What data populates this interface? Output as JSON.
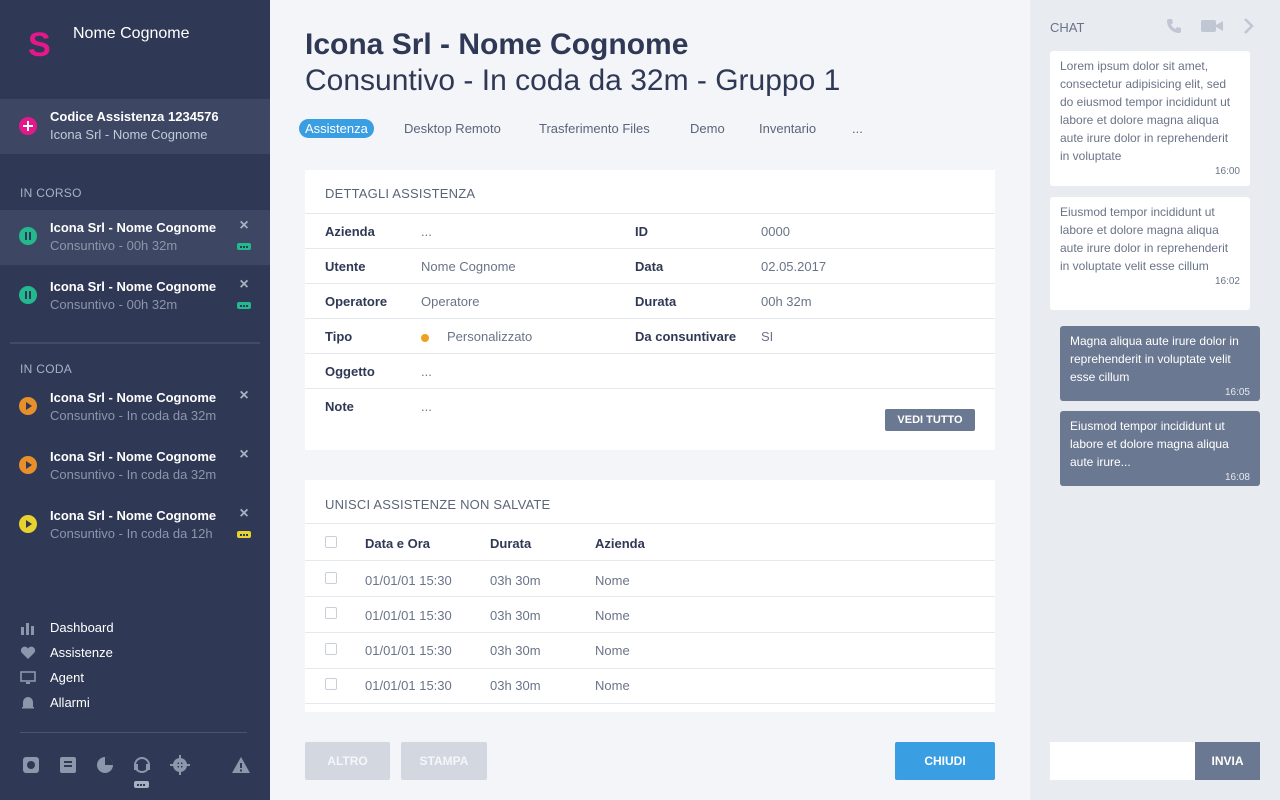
{
  "user": {
    "logo": "S",
    "name": "Nome Cognome"
  },
  "code_box": {
    "title": "Codice Assistenza 1234576",
    "subtitle": "Icona Srl - Nome Cognome"
  },
  "in_corso": {
    "title": "IN CORSO",
    "items": [
      {
        "title": "Icona Srl - Nome Cognome",
        "subtitle": "Consuntivo - 00h 32m",
        "status": "pause",
        "badge": "green"
      },
      {
        "title": "Icona Srl - Nome Cognome",
        "subtitle": "Consuntivo - 00h 32m",
        "status": "pause",
        "badge": "green"
      }
    ]
  },
  "in_coda": {
    "title": "IN CODA",
    "items": [
      {
        "title": "Icona Srl - Nome Cognome",
        "subtitle": "Consuntivo - In coda da 32m",
        "status": "play-orange"
      },
      {
        "title": "Icona Srl - Nome Cognome",
        "subtitle": "Consuntivo - In coda da 32m",
        "status": "play-orange"
      },
      {
        "title": "Icona Srl - Nome Cognome",
        "subtitle": "Consuntivo - In coda da 12h",
        "status": "play-yellow",
        "badge": "yellow"
      }
    ]
  },
  "nav": [
    {
      "label": "Dashboard",
      "icon": "bar-chart-icon"
    },
    {
      "label": "Assistenze",
      "icon": "heart-icon"
    },
    {
      "label": "Agent",
      "icon": "monitor-icon"
    },
    {
      "label": "Allarmi",
      "icon": "bell-icon"
    }
  ],
  "header": {
    "title": "Icona Srl - Nome Cognome",
    "subtitle": "Consuntivo - In coda da 32m - Gruppo 1"
  },
  "tabs": [
    "Assistenza",
    "Desktop Remoto",
    "Trasferimento Files",
    "Demo",
    "Inventario",
    "..."
  ],
  "details": {
    "title": "DETTAGLI ASSISTENZA",
    "rows": [
      {
        "l1": "Azienda",
        "v1": "...",
        "l2": "ID",
        "v2": "0000"
      },
      {
        "l1": "Utente",
        "v1": "Nome Cognome",
        "l2": "Data",
        "v2": "02.05.2017"
      },
      {
        "l1": "Operatore",
        "v1": "Operatore",
        "l2": "Durata",
        "v2": "00h 32m"
      },
      {
        "l1": "Tipo",
        "v1": "Personalizzato",
        "l2": "Da consuntivare",
        "v2": "SI"
      },
      {
        "l1": "Oggetto",
        "v1": "..."
      },
      {
        "l1": "Note",
        "v1": "..."
      }
    ],
    "vedi_tutto": "VEDI TUTTO"
  },
  "merge": {
    "title": "UNISCI ASSISTENZE NON SALVATE",
    "columns": [
      "Data e Ora",
      "Durata",
      "Azienda"
    ],
    "rows": [
      [
        "01/01/01 15:30",
        "03h 30m",
        "Nome"
      ],
      [
        "01/01/01 15:30",
        "03h 30m",
        "Nome"
      ],
      [
        "01/01/01 15:30",
        "03h 30m",
        "Nome"
      ],
      [
        "01/01/01 15:30",
        "03h 30m",
        "Nome"
      ]
    ]
  },
  "actions": {
    "altro": "ALTRO",
    "stampa": "STAMPA",
    "chiudi": "CHIUDI"
  },
  "chat": {
    "title": "CHAT",
    "messages": [
      {
        "dir": "in",
        "text": "Lorem ipsum dolor sit amet, consectetur adipisicing elit, sed do eiusmod tempor incididunt ut labore et dolore magna aliqua aute irure dolor in reprehenderit in voluptate",
        "time": "16:00"
      },
      {
        "dir": "in",
        "text": "Eiusmod tempor incididunt ut labore et dolore magna aliqua aute irure dolor in reprehenderit in voluptate velit esse cillum",
        "time": "16:02"
      },
      {
        "dir": "out",
        "text": "Magna aliqua aute irure dolor in reprehenderit in voluptate velit esse cillum",
        "time": "16:05"
      },
      {
        "dir": "out",
        "text": "Eiusmod tempor incididunt ut labore et dolore magna aliqua aute irure...",
        "time": "16:08"
      }
    ],
    "input_placeholder": "",
    "send": "INVIA"
  },
  "colors": {
    "sidebar": "#2f3855",
    "accent": "#3a9ee2",
    "brand": "#e5188b",
    "status_green": "#22b98f",
    "status_orange": "#e78f2a",
    "status_yellow": "#e8d22f"
  }
}
